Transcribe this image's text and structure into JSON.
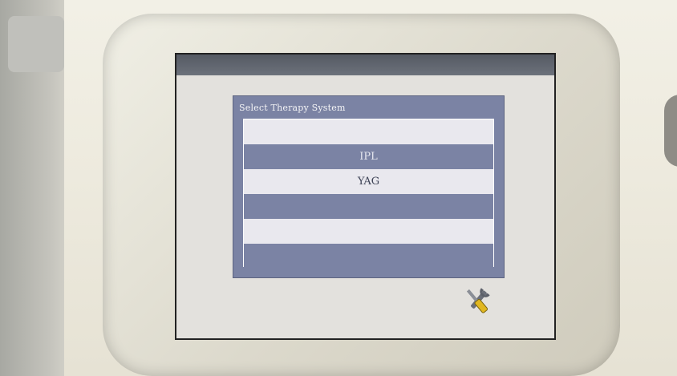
{
  "dialog": {
    "title": "Select Therapy System",
    "options": [
      {
        "label": ""
      },
      {
        "label": "IPL"
      },
      {
        "label": "YAG"
      },
      {
        "label": ""
      },
      {
        "label": ""
      },
      {
        "label": ""
      }
    ]
  },
  "icons": {
    "settings": "tools-icon"
  },
  "colors": {
    "dialog_frame": "#7b83a4",
    "row_light": "#e9e8ee",
    "screen_bg": "#e3e1dd"
  }
}
